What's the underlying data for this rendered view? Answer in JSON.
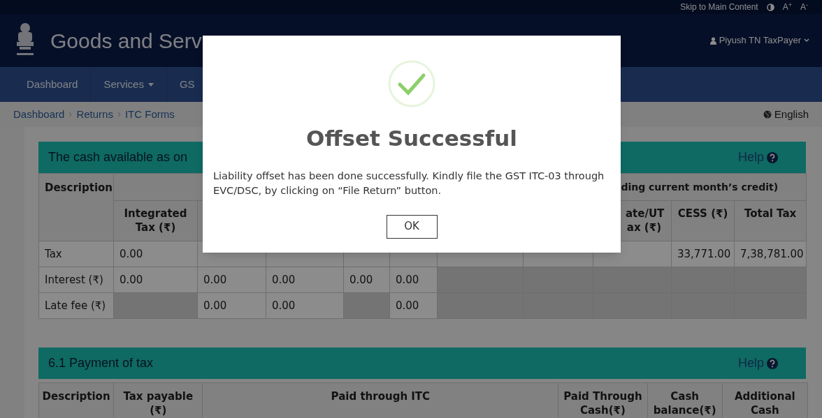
{
  "top_bar": {
    "skip_link": "Skip to Main Content",
    "font_larger": "A$^{+}$",
    "font_smaller": "A$^{-}$"
  },
  "header": {
    "title": "Goods and Serv",
    "user": "Piyush TN TaxPayer"
  },
  "nav": {
    "items": [
      {
        "label": "Dashboard",
        "dropdown": false
      },
      {
        "label": "Services",
        "dropdown": true
      },
      {
        "label": "GS",
        "dropdown": false
      }
    ]
  },
  "breadcrumb": {
    "items": [
      "Dashboard",
      "Returns",
      "ITC Forms"
    ],
    "language": "English"
  },
  "cash_table": {
    "title": "The cash available as on",
    "help": "Help",
    "description_header": "Description",
    "group_header": "ding current month’s credit)",
    "sub_columns": [
      {
        "label": "Integrated Tax (₹)"
      },
      {},
      {},
      {},
      {},
      {},
      {},
      {
        "label": "ate/UT ax (₹)"
      },
      {
        "label": "CESS (₹)"
      },
      {
        "label": "Total Tax"
      }
    ],
    "rows": [
      {
        "label": "Tax",
        "cells": [
          {
            "text": "0.00",
            "disabled": false
          },
          {
            "disabled": false
          },
          {
            "disabled": false
          },
          {
            "disabled": false
          },
          {
            "disabled": false
          },
          {
            "disabled": false
          },
          {
            "disabled": false
          },
          {
            "disabled": false
          },
          {
            "text": "33,771.00",
            "disabled": false
          },
          {
            "text": "7,38,781.00",
            "disabled": false
          }
        ]
      },
      {
        "label": "Interest (₹)",
        "cells": [
          {
            "text": "0.00",
            "disabled": false
          },
          {
            "text": "0.00",
            "disabled": false
          },
          {
            "text": "0.00",
            "disabled": false
          },
          {
            "text": "0.00",
            "disabled": false
          },
          {
            "text": "0.00",
            "disabled": false
          },
          {
            "disabled": true
          },
          {
            "disabled": true
          },
          {
            "disabled": true
          },
          {
            "disabled": true
          },
          {
            "disabled": true
          }
        ]
      },
      {
        "label": "Late fee (₹)",
        "cells": [
          {
            "disabled": true
          },
          {
            "text": "0.00",
            "disabled": false
          },
          {
            "text": "0.00",
            "disabled": false
          },
          {
            "disabled": true
          },
          {
            "text": "0.00",
            "disabled": false
          },
          {
            "disabled": true
          },
          {
            "disabled": true
          },
          {
            "disabled": true
          },
          {
            "disabled": true
          },
          {
            "disabled": true
          }
        ]
      }
    ]
  },
  "payment_table": {
    "title": "6.1 Payment of tax",
    "help": "Help",
    "columns": [
      {
        "label": "Description"
      },
      {
        "label": "Tax payable (₹)"
      },
      {
        "label": "Paid through ITC"
      },
      {
        "label": "Paid Through Cash(₹)"
      },
      {
        "label": "Cash balance(₹)"
      },
      {
        "label": "Additional Cash"
      }
    ]
  },
  "dialog": {
    "title": "Offset Successful",
    "message": "Liability offset has been done successfully. Kindly file the GST ITC-03 through EVC/DSC, by clicking on “File Return” button.",
    "button": "OK"
  }
}
